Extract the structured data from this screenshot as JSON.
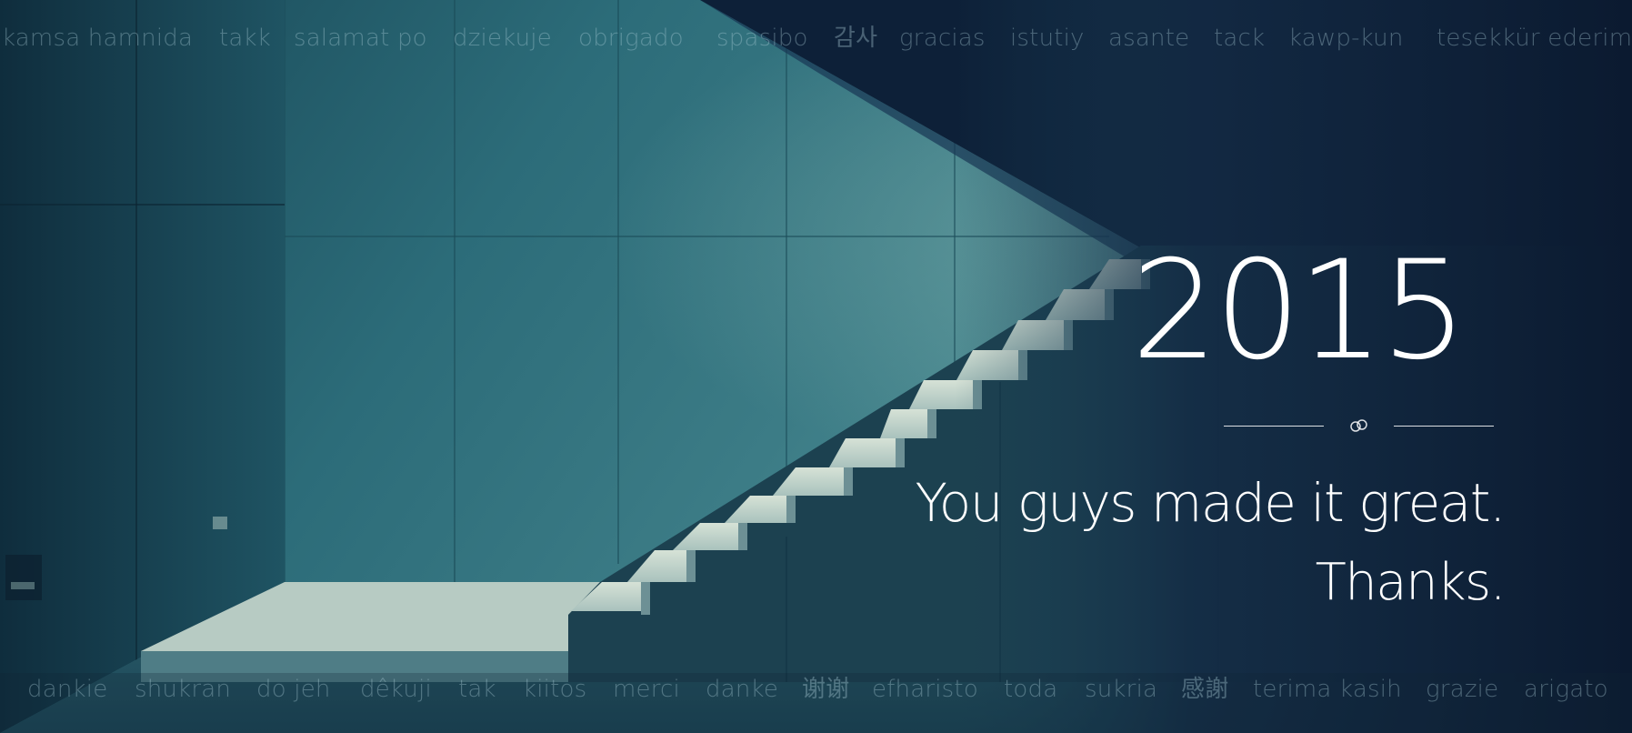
{
  "top_words": [
    "kamsa hamnida",
    "takk",
    "salamat po",
    "dziekuje",
    "obrigado",
    "spasibo",
    "감사",
    "gracias",
    "istutiy",
    "asante",
    "tack",
    "kawp-kun",
    "tesekkür ederim"
  ],
  "bottom_words": [
    "dankie",
    "shukran",
    "do jeh",
    "dêkuji",
    "tak",
    "kiitos",
    "merci",
    "danke",
    "谢谢",
    "efharisto",
    "toda",
    "sukria",
    "感謝",
    "terima kasih",
    "grazie",
    "arigato"
  ],
  "headline": {
    "year": "2015",
    "tagline": "You guys made it great.",
    "thanks": "Thanks."
  },
  "colors": {
    "text": "#ffffff",
    "overlay_text": "#aacdd7",
    "wall_teal": "#2f6f7d",
    "shadow_navy": "#0d1f33",
    "stair_light": "#c8d6cc"
  },
  "icons": {
    "divider_ornament": "double-ring-icon"
  }
}
